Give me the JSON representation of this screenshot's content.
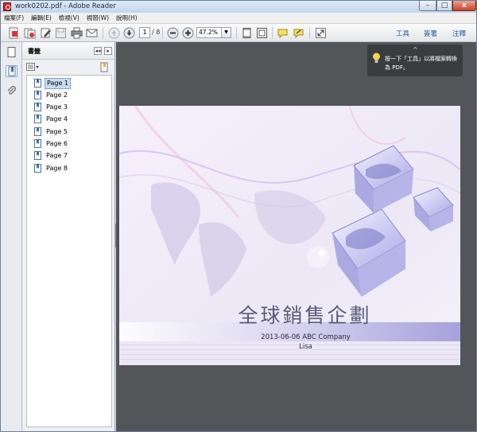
{
  "window": {
    "title": "work0202.pdf - Adobe Reader",
    "min": "–",
    "max": "□",
    "close": "x"
  },
  "menu": [
    "檔案(F)",
    "編輯(E)",
    "檢視(V)",
    "視窗(W)",
    "說明(H)"
  ],
  "toolbar": {
    "page_current": "1",
    "page_total": "/ 8",
    "zoom": "47.2%",
    "zoom_arrow": "▼",
    "links": [
      "工具",
      "簽署",
      "注釋"
    ]
  },
  "panel": {
    "title": "書籤",
    "collapse": "◂◂",
    "close": "▸",
    "bookmarks": [
      "Page 1",
      "Page 2",
      "Page 3",
      "Page 4",
      "Page 5",
      "Page 6",
      "Page 7",
      "Page 8"
    ],
    "selected_index": 0
  },
  "slide": {
    "title": "全球銷售企劃",
    "subtitle": "2013-06-06 ABC Company",
    "author": "Lisa"
  },
  "tip": {
    "text": "按一下「工具」以將檔案轉換為 PDF。",
    "chevron": "^"
  },
  "colors": {
    "accent": "#2f5a9a",
    "doc_bg": "#525659",
    "slide_band": "#9e98d8"
  }
}
